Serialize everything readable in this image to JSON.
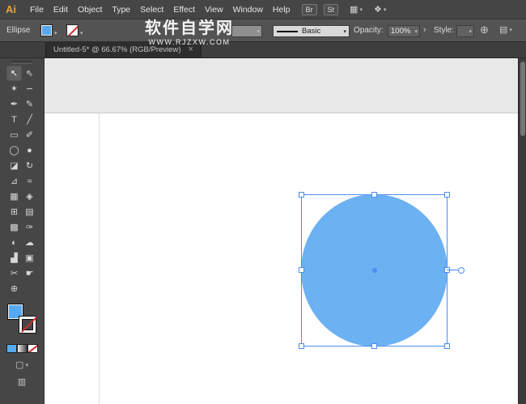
{
  "menu_bar": {
    "logo": "Ai",
    "items": [
      "File",
      "Edit",
      "Object",
      "Type",
      "Select",
      "Effect",
      "View",
      "Window",
      "Help"
    ],
    "br_button": "Br",
    "st_button": "St"
  },
  "icons": {
    "chevron_down": "▾",
    "arrange_documents": "▦",
    "workspace_switcher": "❖",
    "globe": "⊕",
    "document_setup": "▤",
    "panel_arrow": "›",
    "close": "×",
    "draw_mode": "▢",
    "screen_mode": "▥"
  },
  "control_bar": {
    "tool_label": "Ellipse",
    "brush_value": "Basic",
    "opacity_label": "Opacity:",
    "opacity_value": "100%",
    "style_label": "Style:"
  },
  "watermark": {
    "line1": "软件自学网",
    "line2": "WWW.RJZXW.COM"
  },
  "tab": {
    "title": "Untitled-5* @ 66.67% (RGB/Preview)"
  },
  "toolbar": {
    "tools": [
      {
        "name": "selection-tool",
        "glyph": "↖",
        "active": true
      },
      {
        "name": "direct-selection-tool",
        "glyph": "⇖"
      },
      {
        "name": "magic-wand-tool",
        "glyph": "✶"
      },
      {
        "name": "lasso-tool",
        "glyph": "∽"
      },
      {
        "name": "pen-tool",
        "glyph": "✒"
      },
      {
        "name": "pencil-tool",
        "glyph": "✎"
      },
      {
        "name": "type-tool",
        "glyph": "T"
      },
      {
        "name": "line-segment-tool",
        "glyph": "╱"
      },
      {
        "name": "rectangle-tool",
        "glyph": "▭"
      },
      {
        "name": "paintbrush-tool",
        "glyph": "✐"
      },
      {
        "name": "ellipse-tool",
        "glyph": "◯"
      },
      {
        "name": "blob-brush-tool",
        "glyph": "●"
      },
      {
        "name": "eraser-tool",
        "glyph": "◪"
      },
      {
        "name": "rotate-tool",
        "glyph": "↻"
      },
      {
        "name": "scale-tool",
        "glyph": "⊿"
      },
      {
        "name": "width-tool",
        "glyph": "≈"
      },
      {
        "name": "free-transform-tool",
        "glyph": "▦"
      },
      {
        "name": "shape-builder-tool",
        "glyph": "◈"
      },
      {
        "name": "perspective-grid-tool",
        "glyph": "⊞"
      },
      {
        "name": "mesh-tool",
        "glyph": "▤"
      },
      {
        "name": "gradient-tool",
        "glyph": "▩"
      },
      {
        "name": "eyedropper-tool",
        "glyph": "✑"
      },
      {
        "name": "blend-tool",
        "glyph": "◐"
      },
      {
        "name": "symbol-sprayer-tool",
        "glyph": "☁"
      },
      {
        "name": "column-graph-tool",
        "glyph": "▟"
      },
      {
        "name": "artboard-tool",
        "glyph": "▣"
      },
      {
        "name": "slice-tool",
        "glyph": "✂"
      },
      {
        "name": "hand-tool",
        "glyph": "☛"
      },
      {
        "name": "zoom-tool",
        "glyph": "⊕"
      }
    ]
  },
  "colors": {
    "fill_accent": "#58aaf0",
    "circle_fill": "#6cb1f1",
    "selection_blue": "#4b8df2",
    "none_red": "#d12b2b",
    "logo_orange": "#e8a33d"
  },
  "canvas": {
    "object": {
      "type": "ellipse",
      "fill": "#6cb1f1",
      "selected": true
    }
  }
}
